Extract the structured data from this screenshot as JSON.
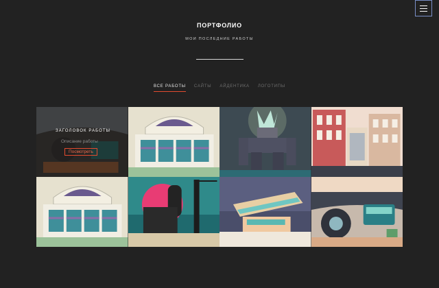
{
  "header": {
    "title": "ПОРТФОЛИО",
    "subtitle": "МОИ ПОСЛЕДНИЕ РАБОТЫ",
    "menu_icon": "hamburger-icon"
  },
  "filters": [
    {
      "label": "ВСЕ РАБОТЫ",
      "active": true
    },
    {
      "label": "САЙТЫ",
      "active": false
    },
    {
      "label": "АЙДЕНТИКА",
      "active": false
    },
    {
      "label": "ЛОГОТИПЫ",
      "active": false
    }
  ],
  "overlay": {
    "title": "ЗАГОЛОВОК РАБОТЫ",
    "description": "Описание работы",
    "button_label": "Посмотреть"
  },
  "gallery": [
    {
      "image": "car-dashboard-illustration"
    },
    {
      "image": "stadium-illustration"
    },
    {
      "image": "robot-illustration"
    },
    {
      "image": "city-buildings-illustration"
    },
    {
      "image": "stadium-illustration"
    },
    {
      "image": "industrial-crane-illustration"
    },
    {
      "image": "modern-building-illustration"
    },
    {
      "image": "car-dashboard-illustration"
    }
  ],
  "colors": {
    "background": "#222222",
    "accent": "#e44b2f",
    "menu_border": "#7a8fc8"
  }
}
